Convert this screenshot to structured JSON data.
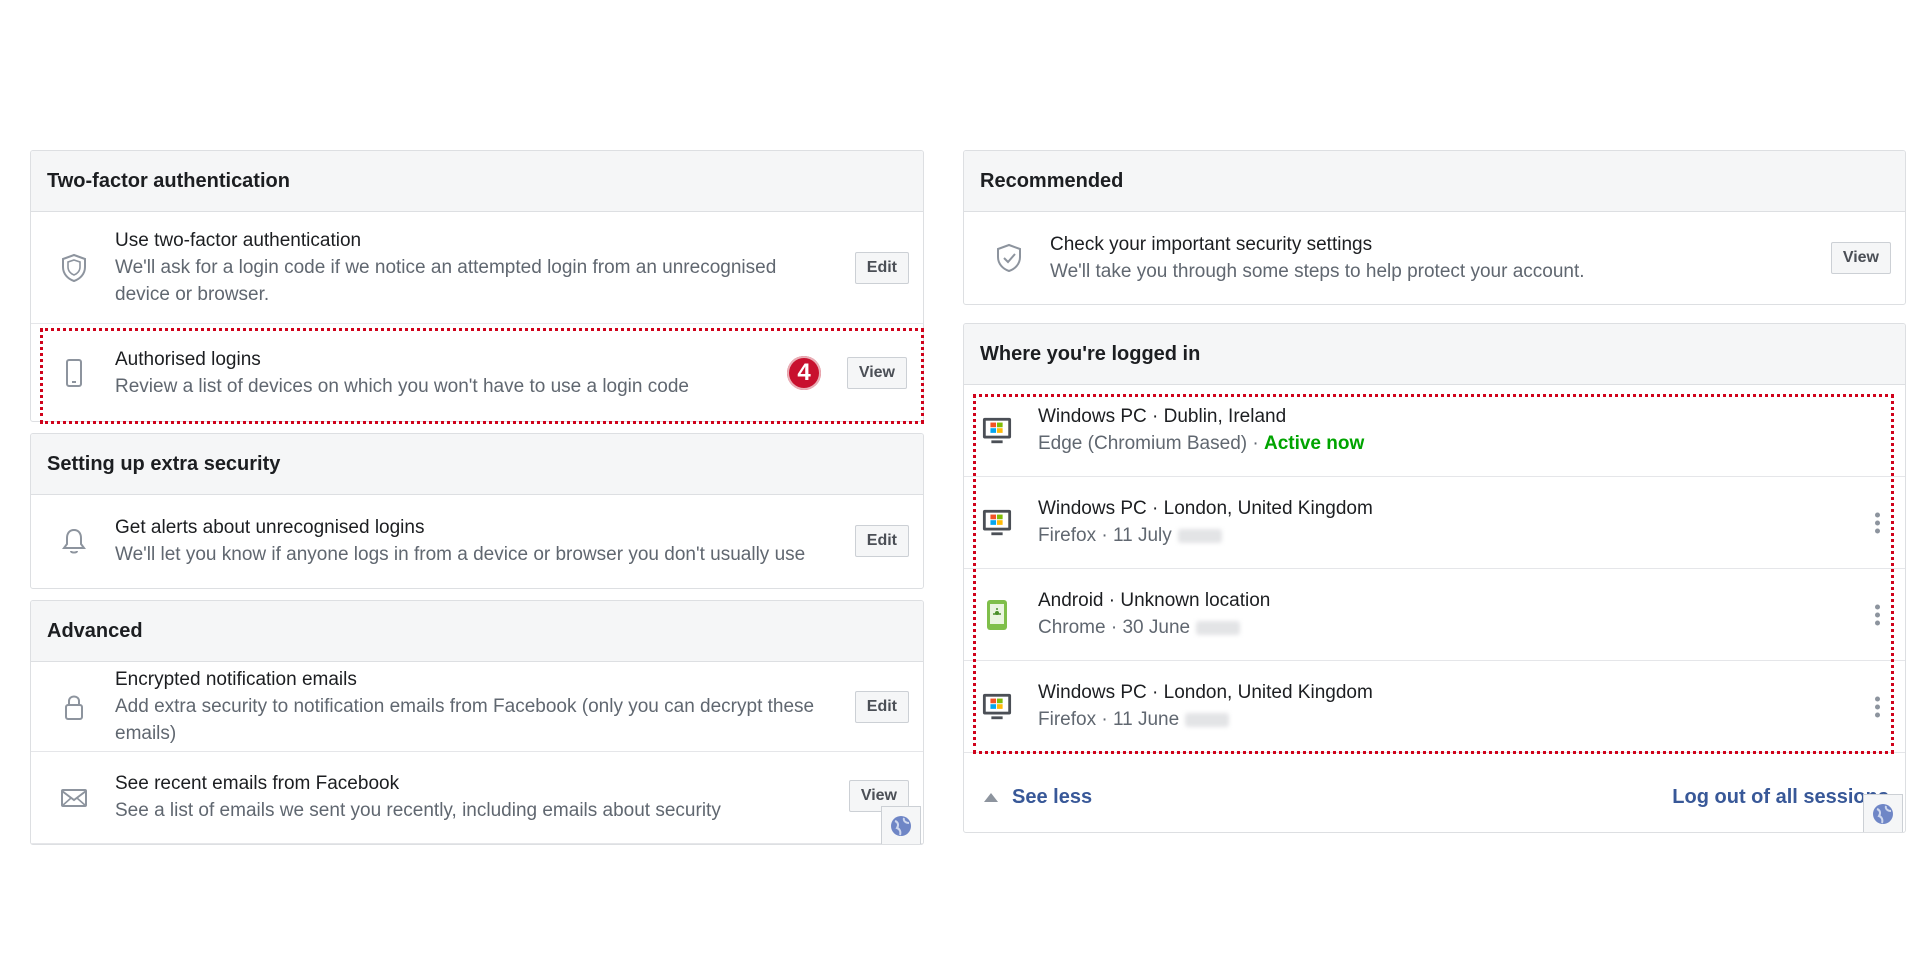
{
  "left": {
    "two_factor": {
      "heading": "Two-factor authentication",
      "items": [
        {
          "title": "Use two-factor authentication",
          "desc": "We'll ask for a login code if we notice an attempted login from an unrecognised device or browser.",
          "button": "Edit"
        },
        {
          "title": "Authorised logins",
          "desc": "Review a list of devices on which you won't have to use a login code",
          "button": "View"
        }
      ],
      "step_badge": "4"
    },
    "extra": {
      "heading": "Setting up extra security",
      "items": [
        {
          "title": "Get alerts about unrecognised logins",
          "desc": "We'll let you know if anyone logs in from a device or browser you don't usually use",
          "button": "Edit"
        }
      ]
    },
    "advanced": {
      "heading": "Advanced",
      "items": [
        {
          "title": "Encrypted notification emails",
          "desc": "Add extra security to notification emails from Facebook (only you can decrypt these emails)",
          "button": "Edit"
        },
        {
          "title": "See recent emails from Facebook",
          "desc": "See a list of emails we sent you recently, including emails about security",
          "button": "View"
        }
      ]
    }
  },
  "right": {
    "recommended": {
      "heading": "Recommended",
      "item": {
        "title": "Check your important security settings",
        "desc": "We'll take you through some steps to help protect your account.",
        "button": "View"
      }
    },
    "sessions": {
      "heading": "Where you're logged in",
      "items": [
        {
          "device": "Windows PC · Dublin, Ireland",
          "browser": "Edge (Chromium Based) · ",
          "status": "Active now",
          "icon": "windows-pc-icon"
        },
        {
          "device": "Windows PC · London, United Kingdom",
          "browser": "Firefox · 11 July",
          "icon": "windows-pc-icon"
        },
        {
          "device": "Android · Unknown location",
          "browser": "Chrome · 30 June",
          "icon": "android-phone-icon"
        },
        {
          "device": "Windows PC · London, United Kingdom",
          "browser": "Firefox · 11 June",
          "icon": "windows-pc-icon"
        }
      ],
      "see_less": "See less",
      "logout_all": "Log out of all sessions"
    }
  },
  "colors": {
    "highlight": "#d0021b",
    "active": "#00a400",
    "link": "#385898"
  }
}
